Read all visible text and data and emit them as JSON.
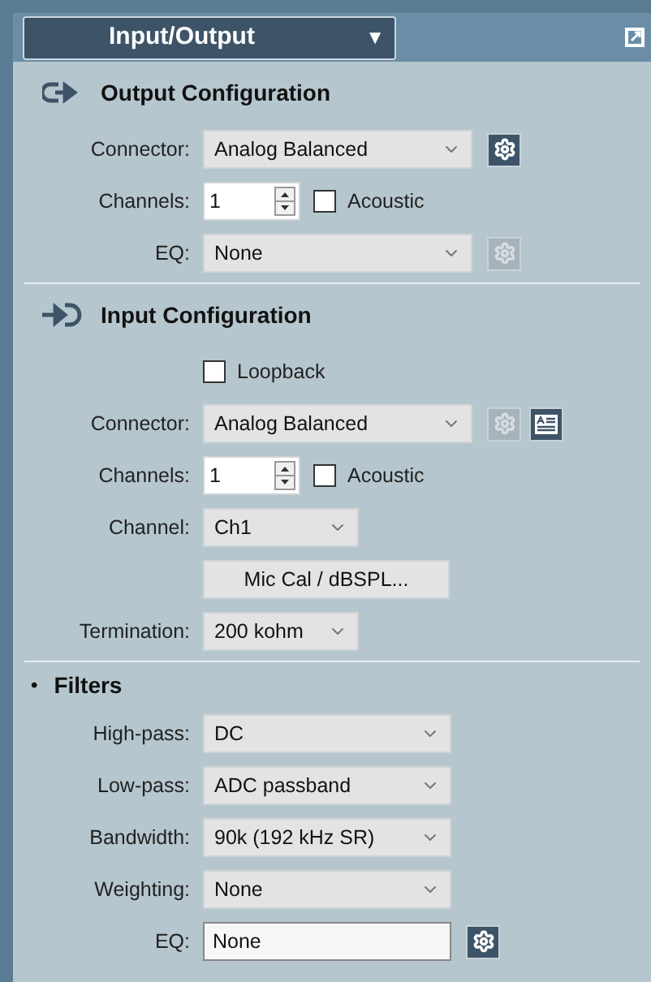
{
  "header": {
    "title": "Input/Output",
    "arrow": "▼"
  },
  "sections": [
    {
      "kind": "output",
      "title": "Output Configuration",
      "rows": [
        {
          "kind": "wide-select",
          "label": "Connector:",
          "value": "Analog Balanced",
          "tools": [
            {
              "kind": "gear",
              "disabled": false
            }
          ]
        },
        {
          "kind": "spinner",
          "label": "Channels:",
          "value": "1",
          "checkbox": {
            "label": "Acoustic",
            "checked": false
          }
        },
        {
          "kind": "wide-select",
          "label": "EQ:",
          "value": "None",
          "tools": [
            {
              "kind": "gear",
              "disabled": true
            }
          ]
        }
      ]
    },
    {
      "kind": "input",
      "title": "Input Configuration",
      "rows": [
        {
          "kind": "checkbox",
          "label": "Loopback",
          "checked": false
        },
        {
          "kind": "wide-select",
          "label": "Connector:",
          "value": "Analog Balanced",
          "tools": [
            {
              "kind": "gear",
              "disabled": true
            },
            {
              "kind": "list",
              "disabled": false
            }
          ]
        },
        {
          "kind": "spinner",
          "label": "Channels:",
          "value": "1",
          "checkbox": {
            "label": "Acoustic",
            "checked": false
          }
        },
        {
          "kind": "short-select",
          "label": "Channel:",
          "value": "Ch1"
        },
        {
          "kind": "button",
          "label": "Mic Cal / dBSPL..."
        },
        {
          "kind": "short-select",
          "label": "Termination:",
          "value": "200 kohm"
        }
      ]
    },
    {
      "kind": "bullet",
      "bullet": "•",
      "title": "Filters",
      "rows": [
        {
          "kind": "select",
          "label": "High-pass:",
          "value": "DC"
        },
        {
          "kind": "select",
          "label": "Low-pass:",
          "value": "ADC passband"
        },
        {
          "kind": "select",
          "label": "Bandwidth:",
          "value": "90k (192 kHz SR)"
        },
        {
          "kind": "select",
          "label": "Weighting:",
          "value": "None"
        },
        {
          "kind": "text",
          "label": "EQ:",
          "value": "None",
          "tools": [
            {
              "kind": "gear",
              "disabled": false
            }
          ]
        }
      ]
    }
  ]
}
